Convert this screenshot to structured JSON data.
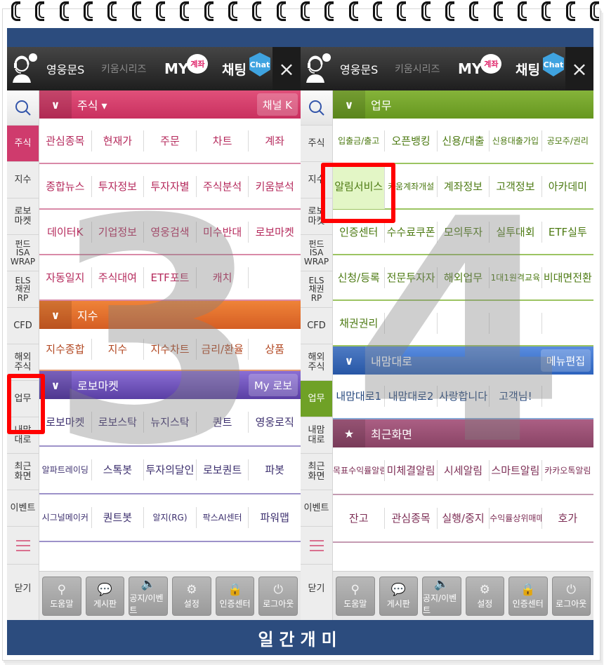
{
  "header": {
    "brand": "영웅문S",
    "series": "키움시리즈",
    "my_label": "MY",
    "my_badge": "계좌",
    "chat_label": "채팅",
    "chat_badge": "Chat",
    "close_icon": "×"
  },
  "overlay_numbers": {
    "left": "3",
    "right": "4"
  },
  "footer": {
    "title": "일간개미"
  },
  "left_panel": {
    "sidebar": [
      {
        "label": "주식",
        "active": true
      },
      {
        "label": "지수"
      },
      {
        "label": "로보\n마켓"
      },
      {
        "label": "펀드\nISA\nWRAP"
      },
      {
        "label": "ELS\n채권\nRP"
      },
      {
        "label": "CFD"
      },
      {
        "label": "해외\n주식"
      },
      {
        "label": "업무"
      },
      {
        "label": "내맘\n대로"
      },
      {
        "label": "최근\n화면"
      },
      {
        "label": "이벤트"
      },
      {
        "label": "닫기"
      }
    ],
    "sections": [
      {
        "title": "주식 ▾",
        "button": "채널 K",
        "rows": [
          [
            "관심종목",
            "현재가",
            "주문",
            "차트",
            "계좌"
          ],
          [
            "종합뉴스",
            "투자정보",
            "투자자별",
            "주식분석",
            "키움분석"
          ],
          [
            "데이터K",
            "기업정보",
            "영웅검색",
            "미수반대",
            "로보마켓"
          ],
          [
            "자동일지",
            "주식대여",
            "ETF포트",
            "캐치",
            ""
          ]
        ]
      },
      {
        "title": "지수",
        "rows": [
          [
            "지수종합",
            "지수",
            "지수차트",
            "금리/환율",
            "상품"
          ]
        ]
      },
      {
        "title": "로보마켓",
        "button": "My 로보",
        "rows": [
          [
            "로보마켓",
            "로보스탁",
            "뉴지스탁",
            "퀀트",
            "영웅로직"
          ],
          [
            "알파트레이딩",
            "스톡봇",
            "투자의달인",
            "로보퀀트",
            "파봇"
          ],
          [
            "시그널메이커",
            "퀀트봇",
            "알지(RG)",
            "팍스AI센터",
            "파워맵"
          ]
        ]
      }
    ]
  },
  "right_panel": {
    "sidebar": [
      {
        "label": "주식"
      },
      {
        "label": "지수"
      },
      {
        "label": "로보\n마켓"
      },
      {
        "label": "펀드\nISA\nWRAP"
      },
      {
        "label": "ELS\n채권\nRP"
      },
      {
        "label": "CFD"
      },
      {
        "label": "해외\n주식"
      },
      {
        "label": "업무",
        "active": true
      },
      {
        "label": "내맘\n대로"
      },
      {
        "label": "최근\n화면"
      },
      {
        "label": "이벤트"
      },
      {
        "label": "닫기"
      }
    ],
    "sections": [
      {
        "title": "업무",
        "rows": [
          [
            "입출금/출고",
            "오픈뱅킹",
            "신용/대출",
            "신용대출가입",
            "공모주/권리"
          ],
          [
            "알림서비스",
            "키움계좌개설",
            "계좌정보",
            "고객정보",
            "아카데미"
          ],
          [
            "인증센터",
            "수수료쿠폰",
            "모의투자",
            "실투대회",
            "ETF실투"
          ],
          [
            "신청/등록",
            "전문투자자",
            "해외업무",
            "1대1원격교육",
            "비대면전환"
          ],
          [
            "채권권리",
            "",
            "",
            "",
            ""
          ]
        ]
      },
      {
        "title": "내맘대로",
        "button": "메뉴편집",
        "rows": [
          [
            "내맘대로1",
            "내맘대로2",
            "사랑합니다",
            "고객님!",
            ""
          ]
        ]
      },
      {
        "title": "최근화면",
        "rows": [
          [
            "목표수익률알림",
            "미체결알림",
            "시세알림",
            "스마트알림",
            "카카오톡알림"
          ],
          [
            "잔고",
            "관심종목",
            "실행/중지",
            "수익률상위매매",
            "호가"
          ]
        ]
      }
    ]
  },
  "toolbar": [
    {
      "label": "도움말",
      "icon": "search-icon"
    },
    {
      "label": "게시판",
      "icon": "chat-bubbles-icon"
    },
    {
      "label": "공지/이벤트",
      "icon": "speaker-icon"
    },
    {
      "label": "설정",
      "icon": "gear-icon"
    },
    {
      "label": "인증센터",
      "icon": "lock-icon"
    },
    {
      "label": "로그아웃",
      "icon": "power-icon"
    }
  ],
  "colors": {
    "stock_pink": "#cf3b6d",
    "index_orange": "#e06d2c",
    "robo_purple": "#6e55bc",
    "work_green": "#6fa126",
    "custom_blue": "#3f75cf",
    "recent_plum": "#964e73",
    "top_band": "#2c4c7e",
    "highlight_red": "#ff0000"
  }
}
